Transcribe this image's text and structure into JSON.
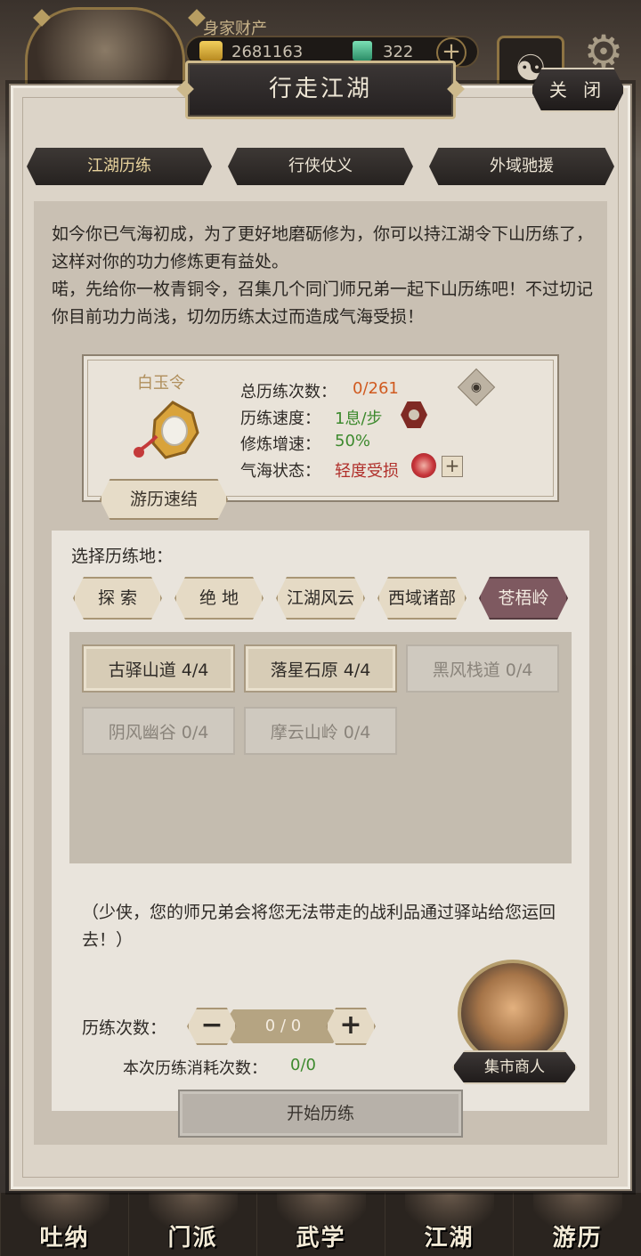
{
  "background": {
    "wealth_label": "身家财产",
    "gold": "2681163",
    "jade": "322",
    "plus": "+",
    "nav": [
      {
        "label": "吐纳"
      },
      {
        "label": "门派"
      },
      {
        "label": "武学"
      },
      {
        "label": "江湖"
      },
      {
        "label": "游历"
      }
    ]
  },
  "dialog": {
    "title": "行走江湖",
    "close_label": "关 闭",
    "tabs": [
      {
        "label": "江湖历练",
        "active": true
      },
      {
        "label": "行侠仗义",
        "active": false
      },
      {
        "label": "外域驰援",
        "active": false
      }
    ],
    "intro": [
      "如今你已气海初成，为了更好地磨砺修为，你可以持江湖令下山历练了，这样对你的功力修炼更有益处。",
      "喏，先给你一枚青铜令，召集几个同门师兄弟一起下山历练吧！不过切记你目前功力尚浅，切勿历练太过而造成气海受损！"
    ],
    "item": {
      "name": "白玉令",
      "stats": [
        {
          "label": "总历练次数：",
          "value": "0/261",
          "color": "#d05a1f"
        },
        {
          "label": "历练速度：",
          "value": "1息/步",
          "color": "#3d8a2e"
        },
        {
          "label": "修炼增速：",
          "value": "50%",
          "color": "#3d8a2e"
        },
        {
          "label": "气海状态：",
          "value": "轻度受损",
          "color": "#b02f2a"
        }
      ],
      "quick_btn": "游历速结",
      "qi_plus": "+"
    },
    "select": {
      "label": "选择历练地：",
      "locations": [
        {
          "label": "探 索",
          "active": false
        },
        {
          "label": "绝 地",
          "active": false
        },
        {
          "label": "江湖风云",
          "active": false
        },
        {
          "label": "西域诸部",
          "active": false
        },
        {
          "label": "苍梧岭",
          "active": true
        }
      ],
      "sub_locations": [
        {
          "label": "古驿山道 4/4",
          "enabled": true
        },
        {
          "label": "落星石原 4/4",
          "enabled": true
        },
        {
          "label": "黑风栈道 0/4",
          "enabled": false
        },
        {
          "label": "阴风幽谷 0/4",
          "enabled": false
        },
        {
          "label": "摩云山岭 0/4",
          "enabled": false
        }
      ]
    },
    "note": "（少侠，您的师兄弟会将您无法带走的战利品通过驿站给您运回去！）",
    "count": {
      "label": "历练次数：",
      "value": "0 / 0",
      "minus": "−",
      "plus": "+"
    },
    "consume": {
      "label": "本次历练消耗次数：",
      "value": "0/0"
    },
    "merchant_label": "集市商人",
    "start_label": "开始历练"
  }
}
